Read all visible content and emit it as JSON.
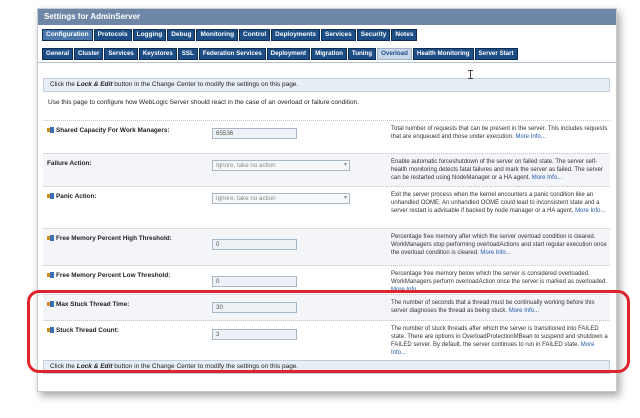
{
  "window": {
    "title": "Settings for AdminServer"
  },
  "tabs_primary": [
    "Configuration",
    "Protocols",
    "Logging",
    "Debug",
    "Monitoring",
    "Control",
    "Deployments",
    "Services",
    "Security",
    "Notes"
  ],
  "tabs_secondary": [
    "General",
    "Cluster",
    "Services",
    "Keystores",
    "SSL",
    "Federation Services",
    "Deployment",
    "Migration",
    "Tuning",
    "Overload",
    "Health Monitoring",
    "Server Start"
  ],
  "info": {
    "prefix": "Click the ",
    "lock_edit": "Lock & Edit",
    "suffix": " button in the Change Center to modify the settings on this page."
  },
  "intro": "Use this page to configure how WebLogic Server should react in the case of an overload or failure condition.",
  "more_info": "More Info...",
  "rows": [
    {
      "label": "Shared Capacity For Work Managers:",
      "value": "65536",
      "desc": "Total number of requests that can be present in the server. This includes requests that are enqueued and those under execution."
    },
    {
      "label": "Failure Action:",
      "value": "Ignore, take no action",
      "desc": "Enable automatic forceshutdown of the server on failed state. The server self-health monitoring detects fatal failures and mark the server as failed. The server can be restarted using NodeManager or a HA agent."
    },
    {
      "label": "Panic Action:",
      "value": "Ignore, take no action",
      "desc": "Exit the server process when the kernel encounters a panic condition like an unhandled OOME. An unhandled OOME could lead to inconsistent state and a server restart is advisable if backed by node manager or a HA agent."
    },
    {
      "label": "Free Memory Percent High Threshold:",
      "value": "0",
      "desc": "Percentage free memory after which the server overload condition is cleared. WorkManagers stop performing overloadActions and start regular execution once the overload condition is cleared."
    },
    {
      "label": "Free Memory Percent Low Threshold:",
      "value": "0",
      "desc": "Percentage free memory below which the server is considered overloaded. WorkManagers perform overloadAction once the server is marked as overloaded."
    },
    {
      "label": "Max Stuck Thread Time:",
      "value": "30",
      "desc": "The number of seconds that a thread must be continually working before this server diagnoses the thread as being stuck."
    },
    {
      "label": "Stuck Thread Count:",
      "value": "3",
      "desc": "The number of stuck threads after which the server is transitioned into FAILED state. There are options in OverloadProtectionMBean to suspend and shutdown a FAILED server. By default, the server continues to run in FAILED state."
    }
  ],
  "colors": {
    "title_bar": "#6f87a6",
    "tab": "#1d4e86",
    "highlight": "#e0242d",
    "link": "#1f57a8"
  }
}
